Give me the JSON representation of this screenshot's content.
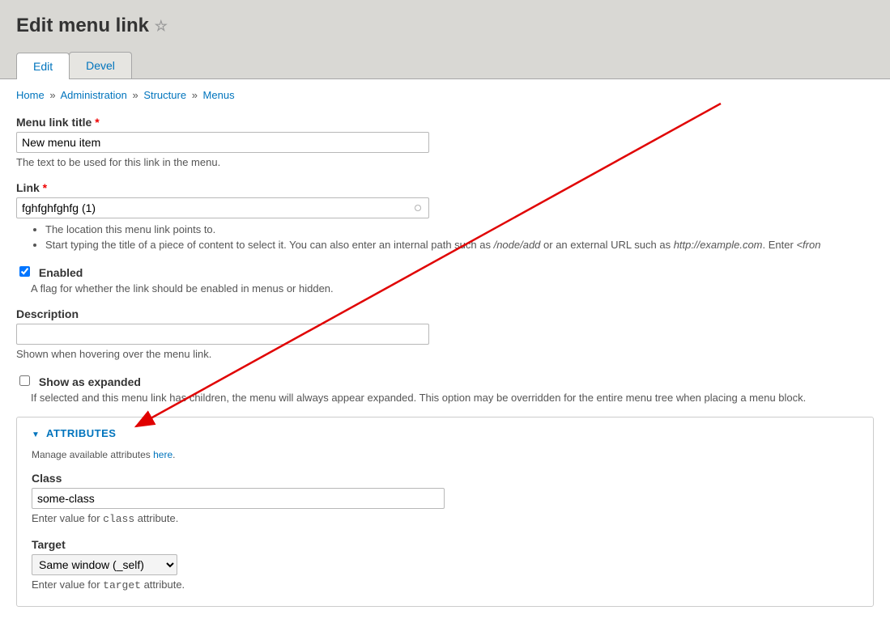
{
  "page": {
    "title": "Edit menu link"
  },
  "tabs": {
    "edit": "Edit",
    "devel": "Devel"
  },
  "breadcrumb": {
    "home": "Home",
    "administration": "Administration",
    "structure": "Structure",
    "menus": "Menus"
  },
  "form": {
    "title_label": "Menu link title",
    "title_value": "New menu item",
    "title_help": "The text to be used for this link in the menu.",
    "link_label": "Link",
    "link_value": "fghfghfghfg (1)",
    "link_help1": "The location this menu link points to.",
    "link_help2_prefix": "Start typing the title of a piece of content to select it. You can also enter an internal path such as ",
    "link_help2_em1": "/node/add",
    "link_help2_mid": " or an external URL such as ",
    "link_help2_em2": "http://example.com",
    "link_help2_suffix": ". Enter ",
    "link_help2_em3": "<fron",
    "enabled_label": "Enabled",
    "enabled_help": "A flag for whether the link should be enabled in menus or hidden.",
    "description_label": "Description",
    "description_value": "",
    "description_help": "Shown when hovering over the menu link.",
    "expanded_label": "Show as expanded",
    "expanded_help": "If selected and this menu link has children, the menu will always appear expanded. This option may be overridden for the entire menu tree when placing a menu block."
  },
  "attributes": {
    "heading": "ATTRIBUTES",
    "manage_prefix": "Manage available attributes ",
    "manage_link": "here",
    "class_label": "Class",
    "class_value": "some-class",
    "class_help_prefix": "Enter value for ",
    "class_help_code": "class",
    "class_help_suffix": " attribute.",
    "target_label": "Target",
    "target_value": "Same window (_self)",
    "target_help_prefix": "Enter value for ",
    "target_help_code": "target",
    "target_help_suffix": " attribute."
  }
}
